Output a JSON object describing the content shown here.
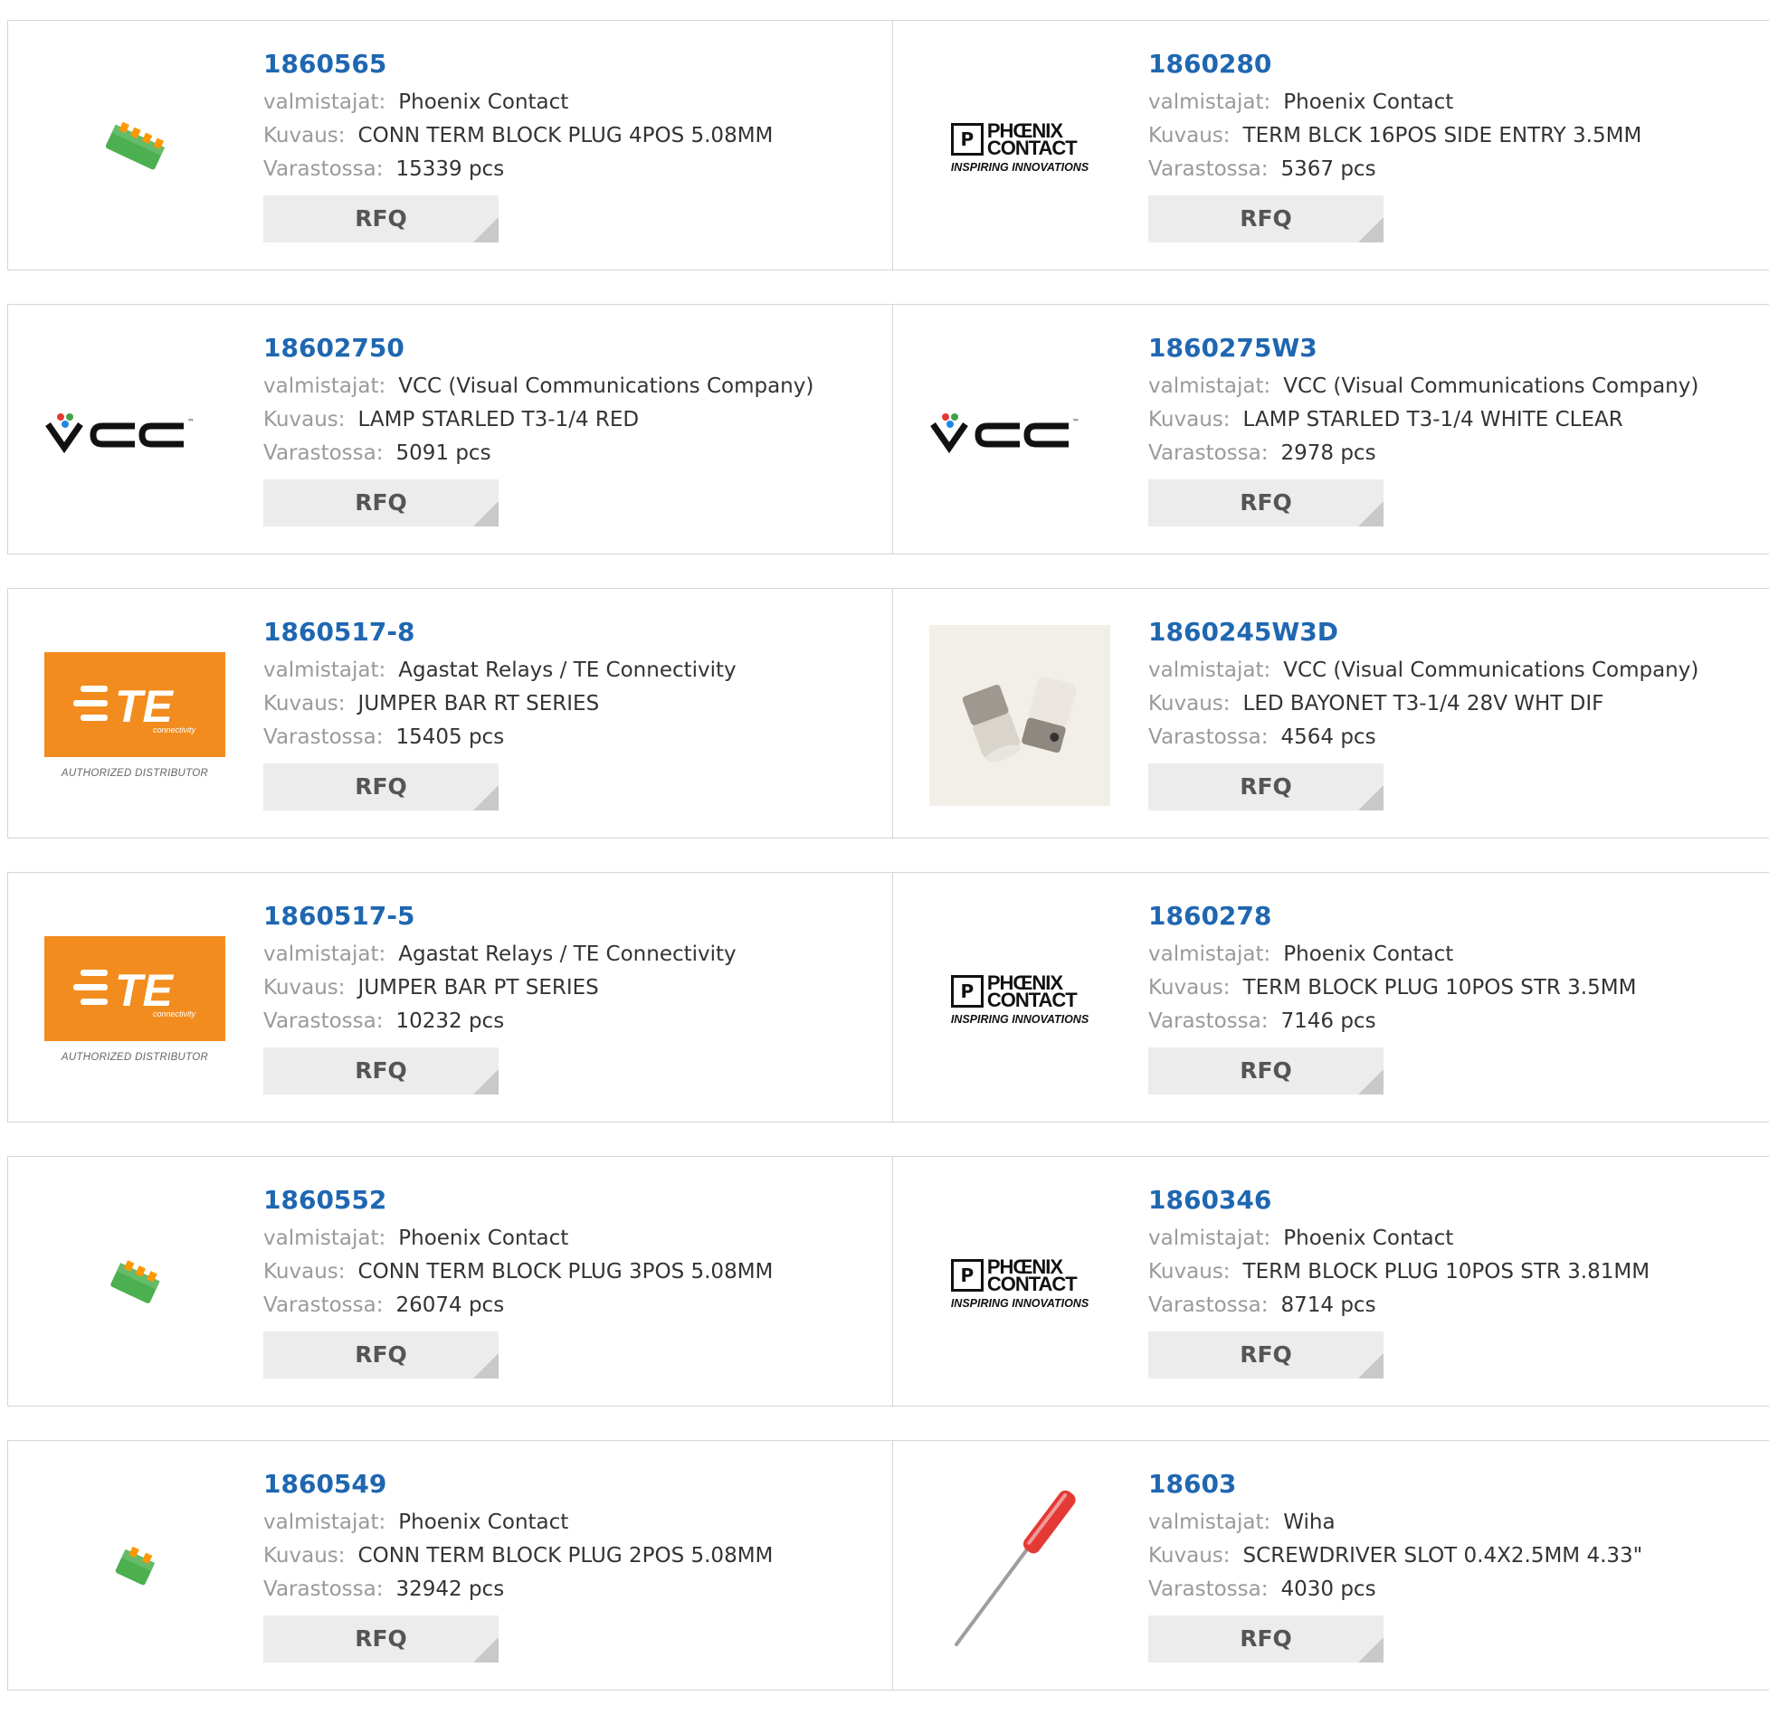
{
  "labels": {
    "manufacturer": "valmistajat:",
    "description": "Kuvaus:",
    "stock": "Varastossa:",
    "rfq": "RFQ"
  },
  "logo_text": {
    "phoenix_top": "PHŒNIX",
    "phoenix_bottom": "CONTACT",
    "phoenix_tag": "INSPIRING INNOVATIONS",
    "te_tag": "AUTHORIZED DISTRIBUTOR",
    "vcc": "VCC"
  },
  "products": [
    {
      "part": "1860565",
      "manufacturer": "Phoenix Contact",
      "description": "CONN TERM BLOCK PLUG 4POS 5.08MM",
      "stock": "15339 pcs",
      "image": "green-terminal-block-photo"
    },
    {
      "part": "1860280",
      "manufacturer": "Phoenix Contact",
      "description": "TERM BLCK 16POS SIDE ENTRY 3.5MM",
      "stock": "5367 pcs",
      "image": "phoenix-contact-logo"
    },
    {
      "part": "18602750",
      "manufacturer": "VCC (Visual Communications Company)",
      "description": "LAMP STARLED T3-1/4 RED",
      "stock": "5091 pcs",
      "image": "vcc-logo"
    },
    {
      "part": "1860275W3",
      "manufacturer": "VCC (Visual Communications Company)",
      "description": "LAMP STARLED T3-1/4 WHITE CLEAR",
      "stock": "2978 pcs",
      "image": "vcc-logo"
    },
    {
      "part": "1860517-8",
      "manufacturer": "Agastat Relays / TE Connectivity",
      "description": "JUMPER BAR RT SERIES",
      "stock": "15405 pcs",
      "image": "te-connectivity-logo"
    },
    {
      "part": "1860245W3D",
      "manufacturer": "VCC (Visual Communications Company)",
      "description": "LED BAYONET T3-1/4 28V WHT DIF",
      "stock": "4564 pcs",
      "image": "led-bayonet-photo"
    },
    {
      "part": "1860517-5",
      "manufacturer": "Agastat Relays / TE Connectivity",
      "description": "JUMPER BAR PT SERIES",
      "stock": "10232 pcs",
      "image": "te-connectivity-logo"
    },
    {
      "part": "1860278",
      "manufacturer": "Phoenix Contact",
      "description": "TERM BLOCK PLUG 10POS STR 3.5MM",
      "stock": "7146 pcs",
      "image": "phoenix-contact-logo"
    },
    {
      "part": "1860552",
      "manufacturer": "Phoenix Contact",
      "description": "CONN TERM BLOCK PLUG 3POS 5.08MM",
      "stock": "26074 pcs",
      "image": "green-terminal-block-photo"
    },
    {
      "part": "1860346",
      "manufacturer": "Phoenix Contact",
      "description": "TERM BLOCK PLUG 10POS STR 3.81MM",
      "stock": "8714 pcs",
      "image": "phoenix-contact-logo"
    },
    {
      "part": "1860549",
      "manufacturer": "Phoenix Contact",
      "description": "CONN TERM BLOCK PLUG 2POS 5.08MM",
      "stock": "32942 pcs",
      "image": "green-terminal-block-photo"
    },
    {
      "part": "18603",
      "manufacturer": "Wiha",
      "description": "SCREWDRIVER SLOT 0.4X2.5MM 4.33\"",
      "stock": "4030 pcs",
      "image": "red-screwdriver-photo"
    }
  ],
  "colors": {
    "link": "#1f67b1",
    "label": "#9a9a9a",
    "button_bg": "#ececec",
    "border": "#d5d5d5",
    "te_orange": "#f28c1e",
    "terminal_green": "#4caf50"
  }
}
